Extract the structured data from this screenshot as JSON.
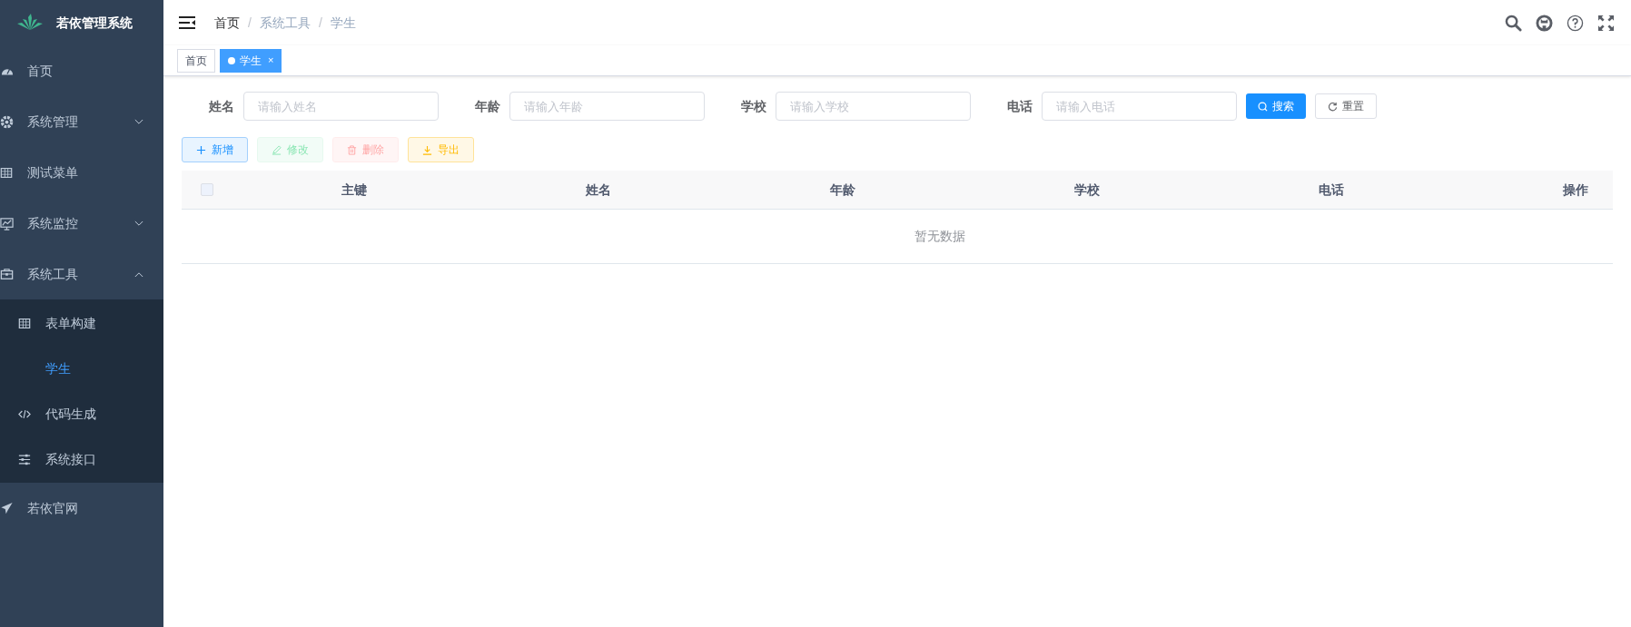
{
  "sidebar": {
    "title": "若依管理系统",
    "items": [
      {
        "label": "首页",
        "selected": false
      },
      {
        "label": "系统管理",
        "selected": false,
        "expanded": false
      },
      {
        "label": "测试菜单",
        "selected": false
      },
      {
        "label": "系统监控",
        "selected": false,
        "expanded": false
      },
      {
        "label": "系统工具",
        "selected": false,
        "expanded": true,
        "children": [
          {
            "label": "表单构建",
            "selected": false
          },
          {
            "label": "学生",
            "selected": true
          },
          {
            "label": "代码生成",
            "selected": false
          },
          {
            "label": "系统接口",
            "selected": false
          }
        ]
      },
      {
        "label": "若依官网",
        "selected": false
      }
    ]
  },
  "breadcrumb": [
    {
      "label": "首页",
      "link": true,
      "separator": "/"
    },
    {
      "label": "系统工具",
      "link": false,
      "separator": "/"
    },
    {
      "label": "学生",
      "link": false
    }
  ],
  "tags": [
    {
      "label": "首页",
      "selected": false
    },
    {
      "label": "学生",
      "selected": true,
      "close": "×"
    }
  ],
  "search_form": {
    "fields": [
      {
        "label": "姓名",
        "placeholder": "请输入姓名"
      },
      {
        "label": "年龄",
        "placeholder": "请输入年龄"
      },
      {
        "label": "学校",
        "placeholder": "请输入学校"
      },
      {
        "label": "电话",
        "placeholder": "请输入电话"
      }
    ],
    "search_button": "搜索",
    "reset_button": "重置"
  },
  "toolbar": [
    {
      "label": "新增",
      "kind": "add",
      "disabled": false
    },
    {
      "label": "修改",
      "kind": "edit",
      "disabled": true
    },
    {
      "label": "删除",
      "kind": "delete",
      "disabled": true
    },
    {
      "label": "导出",
      "kind": "export",
      "disabled": false
    }
  ],
  "table": {
    "select_all_checked": false,
    "columns": [
      "主键",
      "姓名",
      "年龄",
      "学校",
      "电话",
      "操作"
    ],
    "empty_text": "暂无数据"
  }
}
